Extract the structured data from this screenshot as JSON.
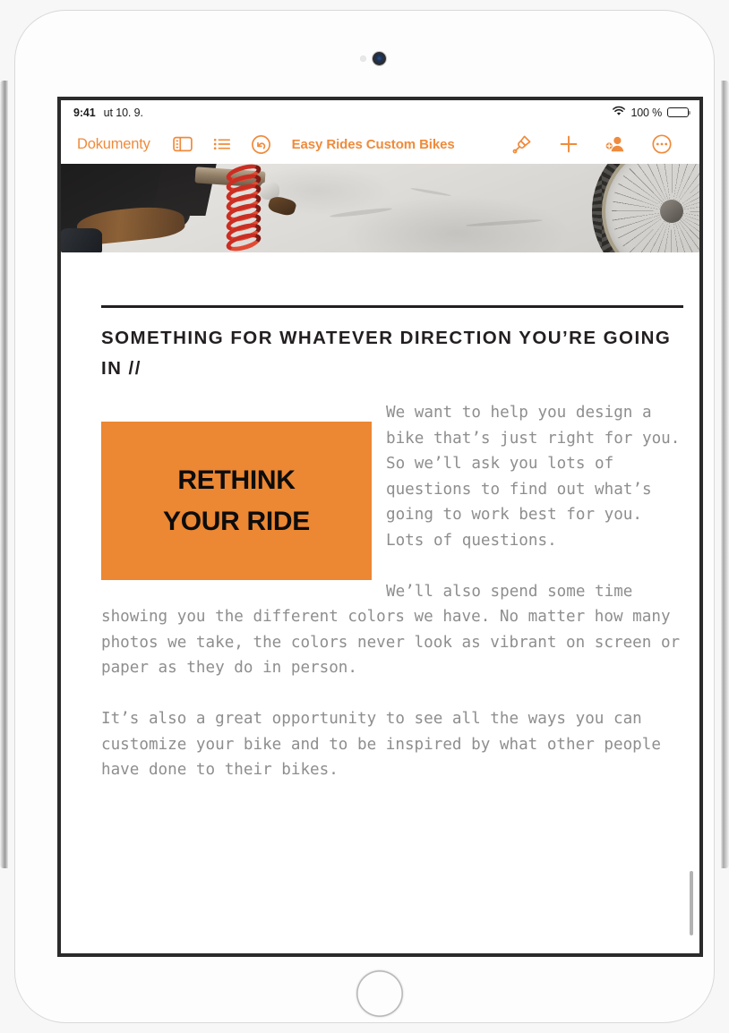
{
  "status_bar": {
    "time": "9:41",
    "date": "ut 10. 9.",
    "wifi_icon": "wifi-icon",
    "battery_percent": "100 %",
    "battery_icon": "battery-full-icon"
  },
  "toolbar": {
    "back_label": "Dokumenty",
    "view_icon": "sidebar-view-icon",
    "list_icon": "bulleted-list-icon",
    "undo_icon": "undo-icon",
    "document_title": "Easy Rides Custom Bikes",
    "format_icon": "paintbrush-format-icon",
    "insert_icon": "plus-insert-icon",
    "collaborate_icon": "add-person-collaborate-icon",
    "more_icon": "ellipsis-more-icon"
  },
  "document": {
    "hero_image_alt": "bicycle-wheel-photo",
    "heading": "SOMETHING FOR WHATEVER DIRECTION YOU’RE GOING IN //",
    "figure": {
      "line1": "RETHINK",
      "line2": "YOUR RIDE",
      "background_color": "#ec8733"
    },
    "paragraphs": [
      "We want to help you design a bike that’s just right for you. So we’ll ask you lots of questions to find out what’s going to work best for you. Lots of questions.",
      "We’ll also spend some time showing you the different colors we have. No matter how many photos we take, the colors never look as vibrant on screen or paper as they do in person.",
      "It’s also a great opportunity to see all the ways you can customize your bike and to be inspired by what other people have done to their bikes."
    ]
  },
  "colors": {
    "accent": "#ef8b3c",
    "figure_orange": "#ec8733",
    "heading_ink": "#231f20",
    "body_gray": "#8e8e8e"
  }
}
